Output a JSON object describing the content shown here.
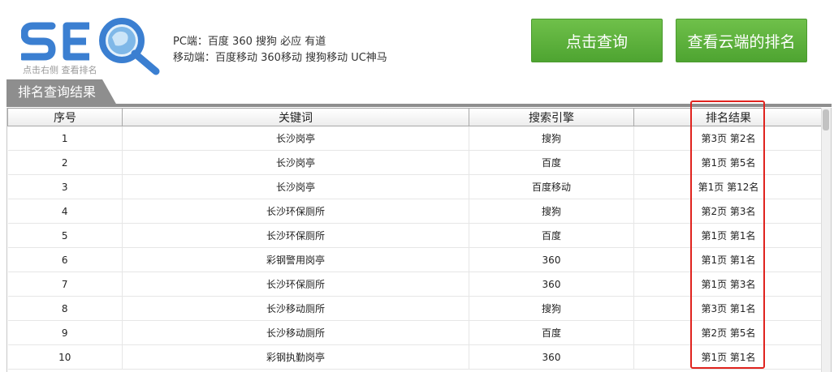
{
  "logo": {
    "text": "SEO",
    "caption": "点击右侧 查看排名",
    "accent": "#3b7fd1"
  },
  "engines": {
    "pc": "PC端：百度 360 搜狗 必应 有道",
    "mobile": "移动端：百度移动 360移动 搜狗移动 UC神马"
  },
  "buttons": {
    "query": "点击查询",
    "cloud": "查看云端的排名",
    "color": "#5cb33a"
  },
  "section": {
    "title": "排名查询结果"
  },
  "table": {
    "headers": [
      "序号",
      "关键词",
      "搜索引擎",
      "排名结果"
    ],
    "rows": [
      [
        "1",
        "长沙岗亭",
        "搜狗",
        "第3页 第2名"
      ],
      [
        "2",
        "长沙岗亭",
        "百度",
        "第1页 第5名"
      ],
      [
        "3",
        "长沙岗亭",
        "百度移动",
        "第1页 第12名"
      ],
      [
        "4",
        "长沙环保厕所",
        "搜狗",
        "第2页 第3名"
      ],
      [
        "5",
        "长沙环保厕所",
        "百度",
        "第1页 第1名"
      ],
      [
        "6",
        "彩钢警用岗亭",
        "360",
        "第1页 第1名"
      ],
      [
        "7",
        "长沙环保厕所",
        "360",
        "第1页 第3名"
      ],
      [
        "8",
        "长沙移动厕所",
        "搜狗",
        "第3页 第1名"
      ],
      [
        "9",
        "长沙移动厕所",
        "百度",
        "第2页 第5名"
      ],
      [
        "10",
        "彩钢执勤岗亭",
        "360",
        "第1页 第1名"
      ]
    ]
  },
  "highlight_color": "#e0231e"
}
